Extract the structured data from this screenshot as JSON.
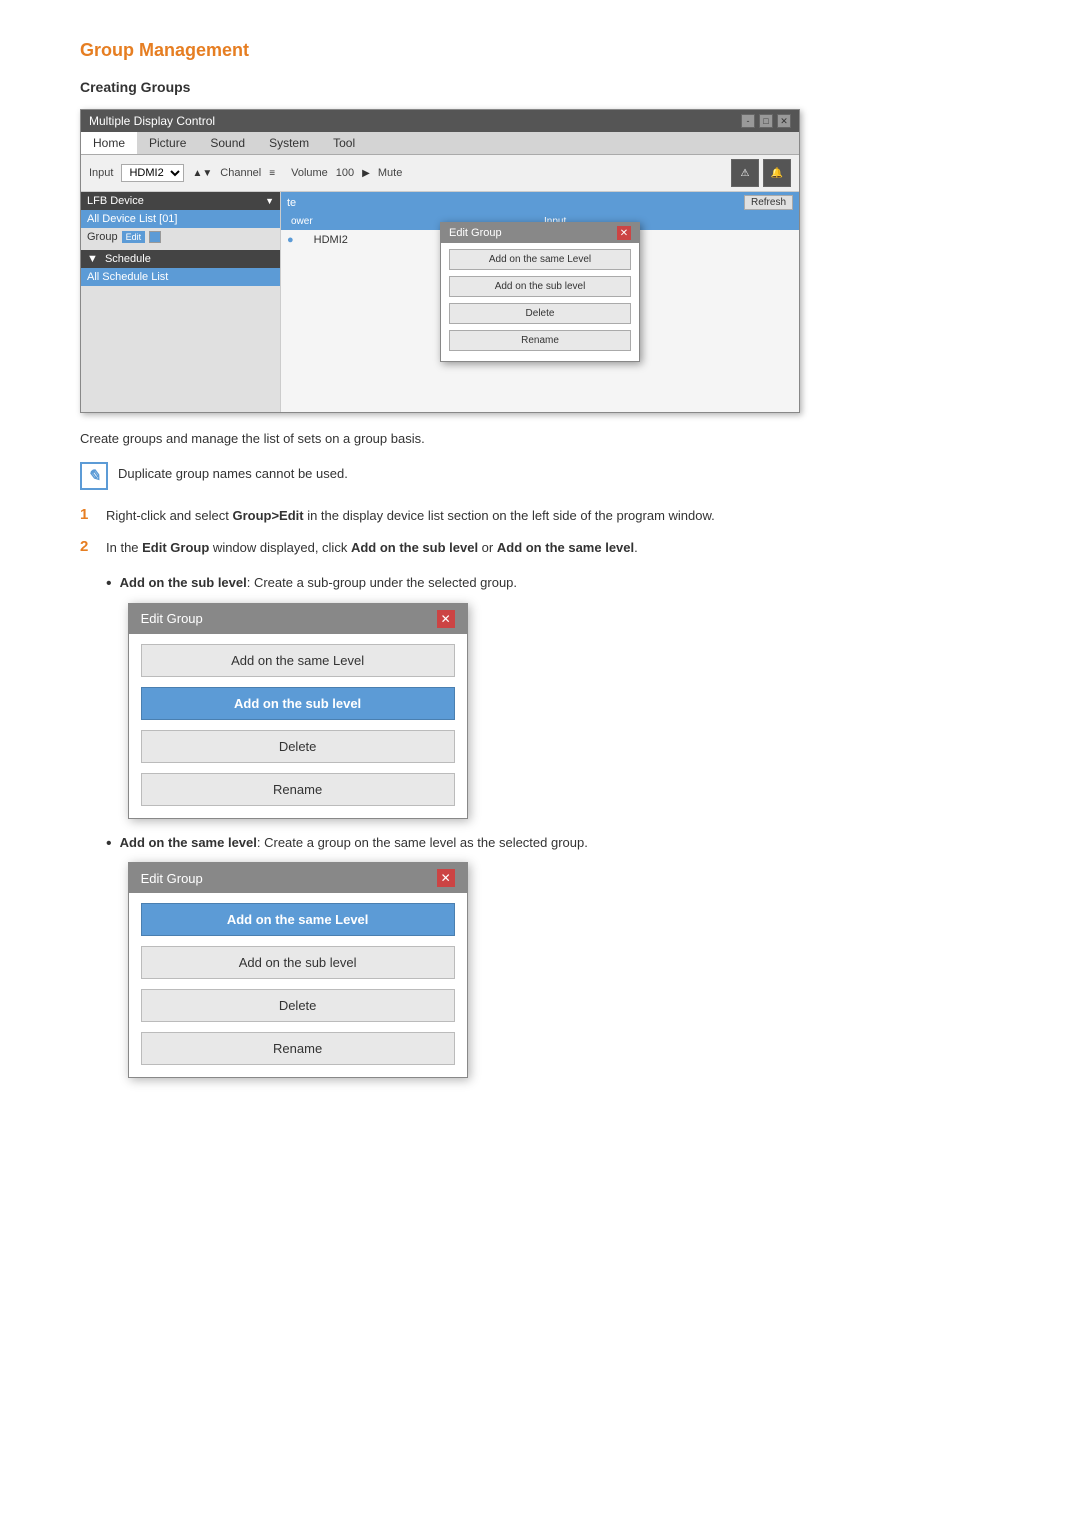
{
  "page": {
    "title": "Group Management",
    "section": "Creating Groups"
  },
  "app_window": {
    "title": "Multiple Display Control",
    "controls": [
      "-",
      "□",
      "✕"
    ],
    "menu_items": [
      "Home",
      "Picture",
      "Sound",
      "System",
      "Tool"
    ],
    "toolbar": {
      "input_label": "Input",
      "channel_label": "Channel",
      "hdmi2_label": "HDMI2",
      "volume_label": "Volume",
      "volume_value": "100",
      "mute_label": "Mute"
    },
    "sidebar": {
      "lfb_header": "LFB Device",
      "all_devices": "All Device List [01]",
      "group_label": "Group",
      "edit_btn": "Edit",
      "schedule_header": "Schedule",
      "all_schedule": "All Schedule List"
    },
    "main": {
      "header": "te",
      "refresh_btn": "Refresh",
      "col_power": "ower",
      "col_input": "Input",
      "input_value": "HDMI2"
    },
    "dialog_small": {
      "title": "Edit Group",
      "close": "✕",
      "buttons": [
        {
          "label": "Add on the same Level",
          "highlighted": false
        },
        {
          "label": "Add on the sub level",
          "highlighted": false
        },
        {
          "label": "Delete",
          "highlighted": false
        },
        {
          "label": "Rename",
          "highlighted": false
        }
      ]
    }
  },
  "description": "Create groups and manage the list of sets on a group basis.",
  "note": {
    "icon": "✎",
    "text": "Duplicate group names cannot be used."
  },
  "steps": [
    {
      "number": "1",
      "text_parts": [
        "Right-click and select ",
        "Group>Edit",
        " in the display device list section on the left side of the program window."
      ]
    },
    {
      "number": "2",
      "text_parts": [
        "In the ",
        "Edit Group",
        " window displayed, click ",
        "Add on the sub level",
        " or ",
        "Add on the same level",
        "."
      ]
    }
  ],
  "sub_items": [
    {
      "label": "Add on the sub level",
      "description": ": Create a sub-group under the selected group.",
      "dialog": {
        "title": "Edit Group",
        "close": "✕",
        "buttons": [
          {
            "label": "Add on the same Level",
            "highlighted": false
          },
          {
            "label": "Add on the sub level",
            "highlighted": true
          },
          {
            "label": "Delete",
            "highlighted": false
          },
          {
            "label": "Rename",
            "highlighted": false
          }
        ]
      }
    },
    {
      "label": "Add on the same level",
      "description": ": Create a group on the same level as the selected group.",
      "dialog": {
        "title": "Edit Group",
        "close": "✕",
        "buttons": [
          {
            "label": "Add on the same Level",
            "highlighted": true
          },
          {
            "label": "Add on the sub level",
            "highlighted": false
          },
          {
            "label": "Delete",
            "highlighted": false
          },
          {
            "label": "Rename",
            "highlighted": false
          }
        ]
      }
    }
  ]
}
